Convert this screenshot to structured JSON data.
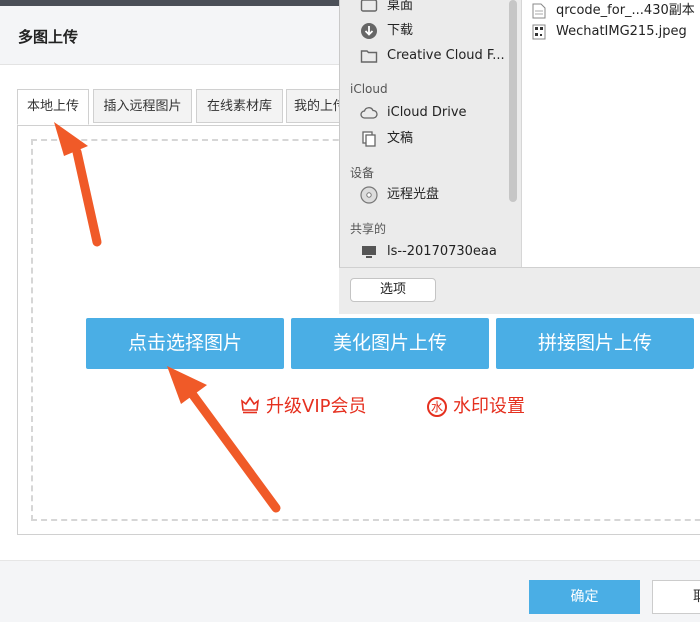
{
  "dialog": {
    "title": "多图上传"
  },
  "tabs": [
    {
      "label": "本地上传",
      "active": true
    },
    {
      "label": "插入远程图片",
      "active": false
    },
    {
      "label": "在线素材库",
      "active": false
    },
    {
      "label": "我的上传",
      "active": false
    }
  ],
  "upload": {
    "select_button": "点击选择图片",
    "beautify_button": "美化图片上传",
    "splice_button": "拼接图片上传",
    "vip_label": "升级VIP会员",
    "vip_icon": "crown-icon",
    "watermark_icon_char": "水",
    "watermark_label": "水印设置"
  },
  "footer": {
    "ok_label": "确定",
    "cancel_label": "取消"
  },
  "finder": {
    "favorites": [
      {
        "label": "桌面",
        "icon": "desktop-icon"
      },
      {
        "label": "下载",
        "icon": "download-icon"
      },
      {
        "label": "Creative Cloud F...",
        "icon": "folder-icon"
      }
    ],
    "icloud_header": "iCloud",
    "icloud": [
      {
        "label": "iCloud Drive",
        "icon": "cloud-icon"
      },
      {
        "label": "文稿",
        "icon": "documents-icon"
      }
    ],
    "devices_header": "设备",
    "devices": [
      {
        "label": "远程光盘",
        "icon": "disc-icon"
      }
    ],
    "shared_header": "共享的",
    "shared": [
      {
        "label": "ls--20170730eaa",
        "icon": "computer-icon"
      }
    ],
    "files": [
      {
        "label": "qrcode_for_...430副本",
        "icon": "file-icon"
      },
      {
        "label": "WechatIMG215.jpeg",
        "icon": "image-file-icon"
      }
    ],
    "options_button": "选项"
  },
  "colors": {
    "accent": "#4aaee5",
    "warning_red": "#e5301f",
    "arrow": "#f05a28"
  }
}
